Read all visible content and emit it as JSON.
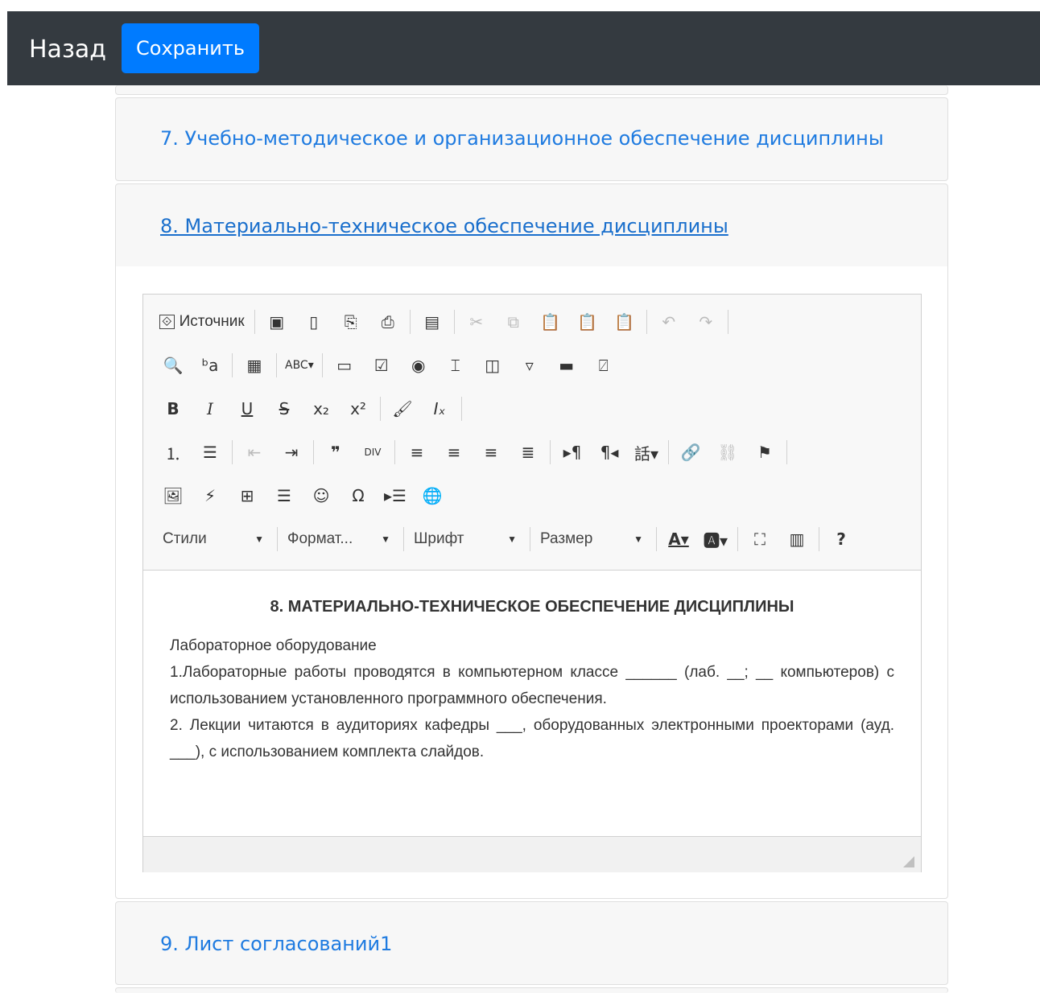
{
  "nav": {
    "back_label": "Назад",
    "save_label": "Сохранить"
  },
  "sections": [
    {
      "label": "7. Учебно-методическое и организационное обеспечение дисциплины"
    },
    {
      "label": "8. Материально-техническое обеспечение дисциплины"
    },
    {
      "label": "9. Лист согласований1"
    }
  ],
  "editor": {
    "toolbar": {
      "source_label": "Источник",
      "styles_label": "Стили",
      "format_label": "Формат...",
      "font_label": "Шрифт",
      "size_label": "Размер"
    },
    "heading": "8. МАТЕРИАЛЬНО-ТЕХНИЧЕСКОЕ ОБЕСПЕЧЕНИЕ ДИСЦИПЛИНЫ",
    "paragraphs": [
      "Лабораторное оборудование",
      "1.Лабораторные работы проводятся в компьютерном классе ______ (лаб. __; __ компьютеров) с использованием установленного программного обеспечения.",
      "2. Лекции читаются в аудиториях кафедры ___, оборудованных электронными проекторами (ауд. ___), с использованием комплекта слайдов."
    ]
  },
  "colors": {
    "topbar": "#343a40",
    "primary": "#007bff",
    "link": "#1f7be0"
  }
}
